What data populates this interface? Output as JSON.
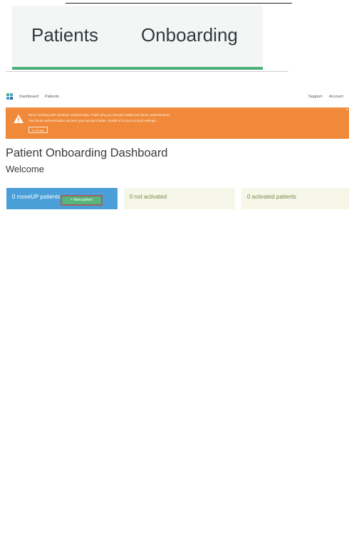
{
  "zoom": {
    "word1": "Patients",
    "word2": "Onboarding"
  },
  "nav": {
    "links": [
      "Dashboard",
      "Patients"
    ],
    "support": "Support",
    "account": "Account"
  },
  "alert": {
    "line1": "We're working with sensitive medical data. That's why you should enable two factor authentication.",
    "line2": "Two factor authentication secures your account better. Enable it in your account settings.",
    "fix_label": "✎ Fix this",
    "close": "×"
  },
  "page": {
    "title": "Patient Onboarding Dashboard",
    "subtitle": "Welcome"
  },
  "cards": {
    "moveup": "0 moveUP patients",
    "not_activated": "0 not activated",
    "activated": "0 activated patients"
  },
  "new_patient_label": "+ New patient",
  "colors": {
    "alert": "#f0893a",
    "primary_card": "#4a9fd8",
    "secondary_card": "#f6f6e9",
    "accent_green": "#4cae7a"
  }
}
